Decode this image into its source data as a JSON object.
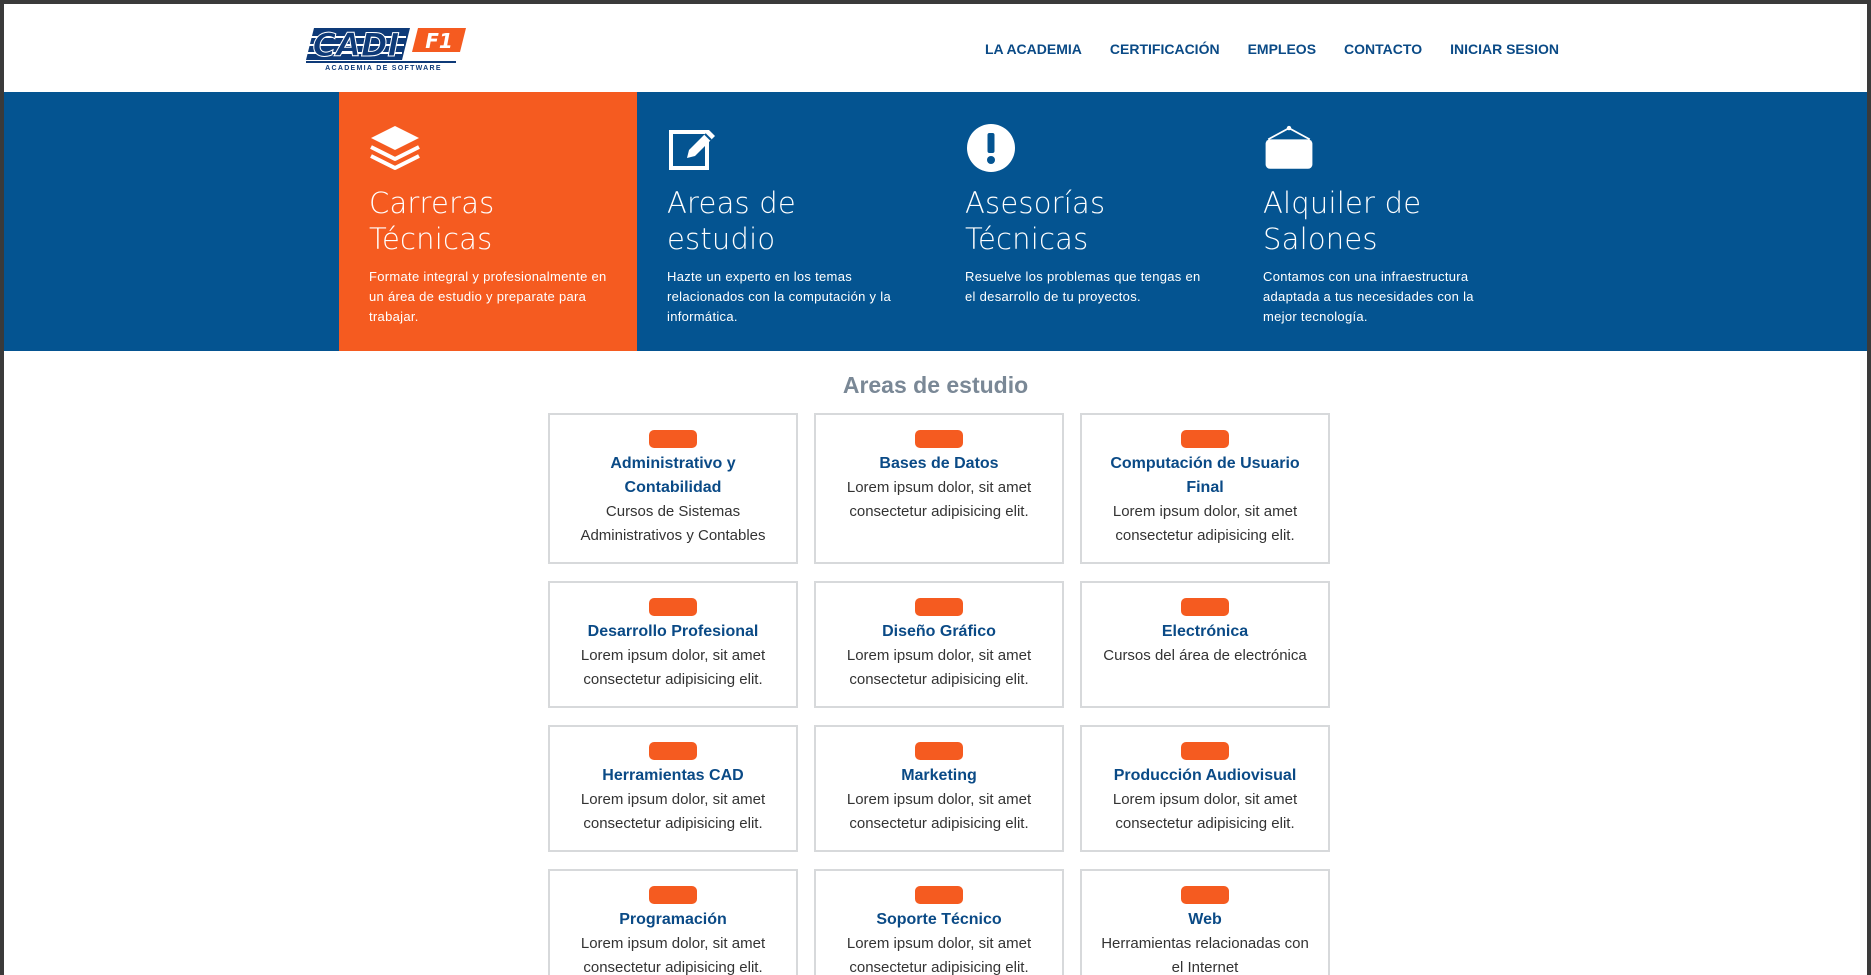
{
  "header": {
    "logo": {
      "text": "CADI",
      "badge": "F1",
      "tagline": "ACADEMIA DE SOFTWARE"
    },
    "nav": [
      "LA ACADEMIA",
      "CERTIFICACIÓN",
      "EMPLEOS",
      "CONTACTO",
      "INICIAR SESION"
    ]
  },
  "hero": {
    "cards": [
      {
        "title": "Carreras Técnicas",
        "desc": "Formate integral y profesionalmente en un área de estudio y preparate para trabajar.",
        "icon": "layers-icon"
      },
      {
        "title": "Areas de estudio",
        "desc": "Hazte un experto en los temas relacionados con la computación y la informática.",
        "icon": "edit-icon"
      },
      {
        "title": "Asesorías Técnicas",
        "desc": "Resuelve los problemas que tengas en el desarrollo de tu proyectos.",
        "icon": "exclamation-icon"
      },
      {
        "title": "Alquiler de Salones",
        "desc": "Contamos con una infraestructura adaptada a tus necesidades con la mejor tecnología.",
        "icon": "hanging-sign-icon"
      }
    ]
  },
  "areas": {
    "title": "Areas de estudio",
    "items": [
      {
        "title": "Administrativo y Contabilidad",
        "desc": "Cursos de Sistemas Administrativos y Contables"
      },
      {
        "title": "Bases de Datos",
        "desc": "Lorem ipsum dolor, sit amet consectetur adipisicing elit."
      },
      {
        "title": "Computación de Usuario Final",
        "desc": "Lorem ipsum dolor, sit amet consectetur adipisicing elit."
      },
      {
        "title": "Desarrollo Profesional",
        "desc": "Lorem ipsum dolor, sit amet consectetur adipisicing elit."
      },
      {
        "title": "Diseño Gráfico",
        "desc": "Lorem ipsum dolor, sit amet consectetur adipisicing elit."
      },
      {
        "title": "Electrónica",
        "desc": "Cursos del área de electrónica"
      },
      {
        "title": "Herramientas CAD",
        "desc": "Lorem ipsum dolor, sit amet consectetur adipisicing elit."
      },
      {
        "title": "Marketing",
        "desc": "Lorem ipsum dolor, sit amet consectetur adipisicing elit."
      },
      {
        "title": "Producción Audiovisual",
        "desc": "Lorem ipsum dolor, sit amet consectetur adipisicing elit."
      },
      {
        "title": "Programación",
        "desc": "Lorem ipsum dolor, sit amet consectetur adipisicing elit."
      },
      {
        "title": "Soporte Técnico",
        "desc": "Lorem ipsum dolor, sit amet consectetur adipisicing elit."
      },
      {
        "title": "Web",
        "desc": "Herramientas relacionadas con el Internet"
      }
    ]
  },
  "colors": {
    "primary": "#045491",
    "accent": "#f55b20",
    "nav_text": "#0a4a86"
  }
}
